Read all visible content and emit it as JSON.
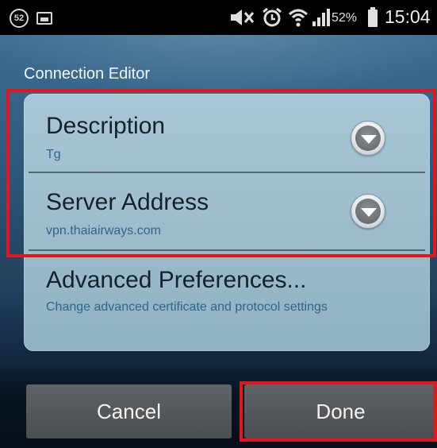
{
  "status_bar": {
    "badge": "52",
    "battery_percent": "52%",
    "time": "15:04",
    "icons": [
      "notification-badge-icon",
      "image-icon",
      "mute-icon",
      "alarm-icon",
      "wifi-icon",
      "signal-icon",
      "battery-icon"
    ]
  },
  "editor": {
    "title": "Connection Editor"
  },
  "fields": [
    {
      "title": "Description",
      "value": "Tg"
    },
    {
      "title": "Server Address",
      "value": "vpn.thaiairways.com"
    }
  ],
  "advanced": {
    "title": "Advanced Preferences...",
    "subtitle": "Change advanced certificate and protocol settings"
  },
  "buttons": {
    "cancel": "Cancel",
    "done": "Done"
  },
  "colors": {
    "highlight": "#e4151c",
    "panel": "#a8c6d6",
    "link_text": "#2d6690"
  }
}
